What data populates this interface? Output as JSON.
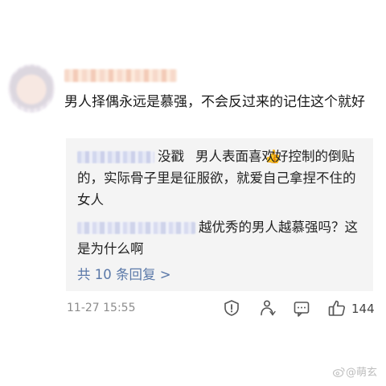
{
  "comment": {
    "text": "男人择偶永远是慕强，不会反过来的记住这个就好"
  },
  "replies": [
    {
      "text_before_emoji": "没戳",
      "emoji": "👍",
      "text_after_emoji": "男人表面喜欢好控制的倒贴的，实际骨子里是征服欲，就爱自己拿捏不住的女人"
    },
    {
      "text": "越优秀的男人越慕强吗？这是为什么啊"
    }
  ],
  "more_replies_label": "共 10 条回复 >",
  "meta": {
    "timestamp": "11-27 15:55",
    "like_count": "144"
  },
  "icons": {
    "report": "report-icon",
    "share": "share-icon",
    "comment": "comment-icon",
    "like": "thumbs-up-icon",
    "watermark": "weibo-icon"
  },
  "watermark": {
    "text": "@萌玄"
  },
  "colors": {
    "link": "#5a78a8",
    "reply_bg": "#f4f4f4",
    "meta_text": "#8c8c8c"
  }
}
